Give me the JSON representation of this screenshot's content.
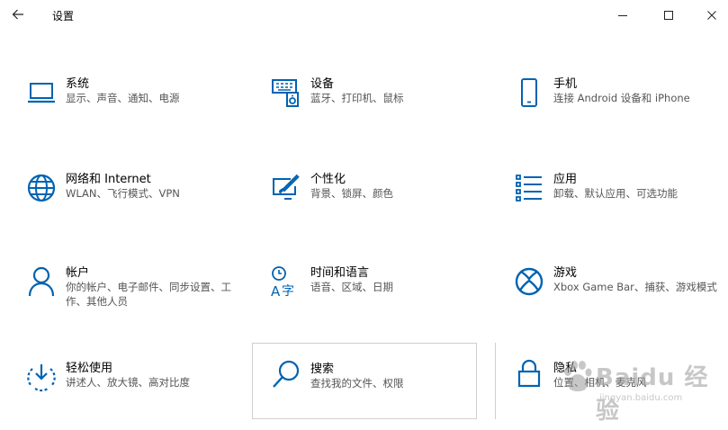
{
  "window": {
    "title": "设置"
  },
  "tiles": [
    {
      "name": "系统",
      "desc": "显示、声音、通知、电源",
      "icon": "laptop-icon"
    },
    {
      "name": "设备",
      "desc": "蓝牙、打印机、鼠标",
      "icon": "devices-icon"
    },
    {
      "name": "手机",
      "desc": "连接 Android 设备和 iPhone",
      "icon": "phone-icon"
    },
    {
      "name": "网络和 Internet",
      "desc": "WLAN、飞行模式、VPN",
      "icon": "globe-icon"
    },
    {
      "name": "个性化",
      "desc": "背景、锁屏、颜色",
      "icon": "personalization-icon"
    },
    {
      "name": "应用",
      "desc": "卸载、默认应用、可选功能",
      "icon": "apps-list-icon"
    },
    {
      "name": "帐户",
      "desc": "你的帐户、电子邮件、同步设置、工作、其他人员",
      "icon": "person-icon"
    },
    {
      "name": "时间和语言",
      "desc": "语音、区域、日期",
      "icon": "time-language-icon"
    },
    {
      "name": "游戏",
      "desc": "Xbox Game Bar、捕获、游戏模式",
      "icon": "xbox-icon"
    },
    {
      "name": "轻松使用",
      "desc": "讲述人、放大镜、高对比度",
      "icon": "ease-of-access-icon"
    },
    {
      "name": "搜索",
      "desc": "查找我的文件、权限",
      "icon": "search-icon"
    },
    {
      "name": "隐私",
      "desc": "位置、相机、麦克风",
      "icon": "lock-icon"
    }
  ],
  "watermark": {
    "brand": "Baidu 经验",
    "url": "jingyan.baidu.com"
  },
  "colors": {
    "accent": "#0063b1",
    "text": "#000000",
    "secondary_text": "#555555",
    "hover_border": "#cfcfcf"
  }
}
